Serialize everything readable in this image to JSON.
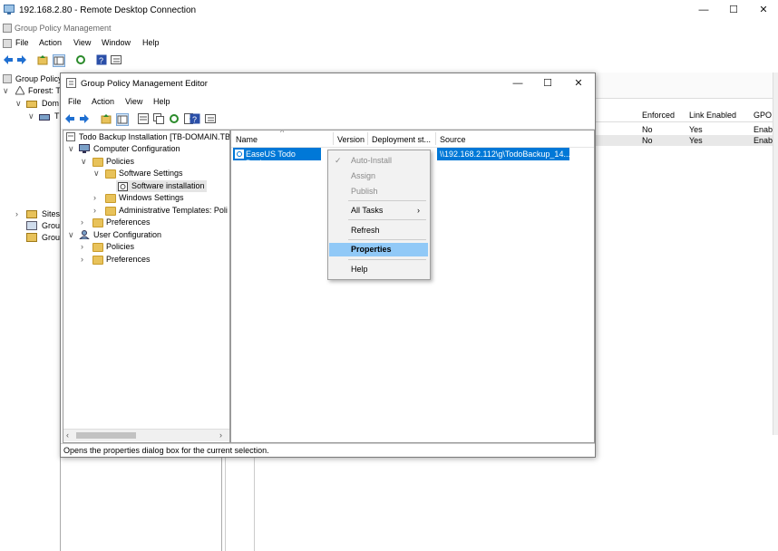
{
  "rdp": {
    "title": "192.168.2.80 - Remote Desktop Connection",
    "minimize": "—",
    "maximize": "☐",
    "close": "✕"
  },
  "gpmc": {
    "title": "Group Policy Management",
    "menu": [
      "File",
      "Action",
      "View",
      "Window",
      "Help"
    ],
    "tree": {
      "root": "Group Policy",
      "forest": "Forest: T",
      "domains": "Dom",
      "domain": "T",
      "sites": "Sites",
      "group1": "Grou",
      "group2": "Grou"
    },
    "table": {
      "headers": [
        "Enforced",
        "Link Enabled",
        "GPO"
      ],
      "rows": [
        [
          "No",
          "Yes",
          "Enab"
        ],
        [
          "No",
          "Yes",
          "Enab"
        ]
      ]
    }
  },
  "editor": {
    "title": "Group Policy Management Editor",
    "menu": [
      "File",
      "Action",
      "View",
      "Help"
    ],
    "tree": {
      "root": "Todo Backup Installation [TB-DOMAIN.TB",
      "computer_config": "Computer Configuration",
      "policies": "Policies",
      "software_settings": "Software Settings",
      "software_installation": "Software installation",
      "windows_settings": "Windows Settings",
      "admin_templates": "Administrative Templates: Poli",
      "preferences": "Preferences",
      "user_config": "User Configuration",
      "user_policies": "Policies",
      "user_preferences": "Preferences"
    },
    "list": {
      "columns": [
        "Name",
        "Version",
        "Deployment st...",
        "Source"
      ],
      "rows": [
        {
          "name": "EaseUS Todo Backup",
          "source": "\\\\192.168.2.112\\g\\TodoBackup_14..."
        }
      ]
    },
    "status": "Opens the properties dialog box for the current selection."
  },
  "context_menu": {
    "items": [
      {
        "label": "Auto-Install",
        "enabled": false,
        "checked": true
      },
      {
        "label": "Assign",
        "enabled": false
      },
      {
        "label": "Publish",
        "enabled": false
      },
      {
        "label": "All Tasks",
        "enabled": true,
        "submenu": true
      },
      {
        "label": "Refresh",
        "enabled": true
      },
      {
        "label": "Properties",
        "enabled": true,
        "highlighted": true
      },
      {
        "label": "Help",
        "enabled": true
      }
    ],
    "submenu_arrow": "›",
    "check": "✓"
  },
  "colors": {
    "selection": "#0078d7",
    "menu_highlight": "#91c9f7",
    "folder": "#e8c25a",
    "disabled_text": "#8a8a8a"
  }
}
